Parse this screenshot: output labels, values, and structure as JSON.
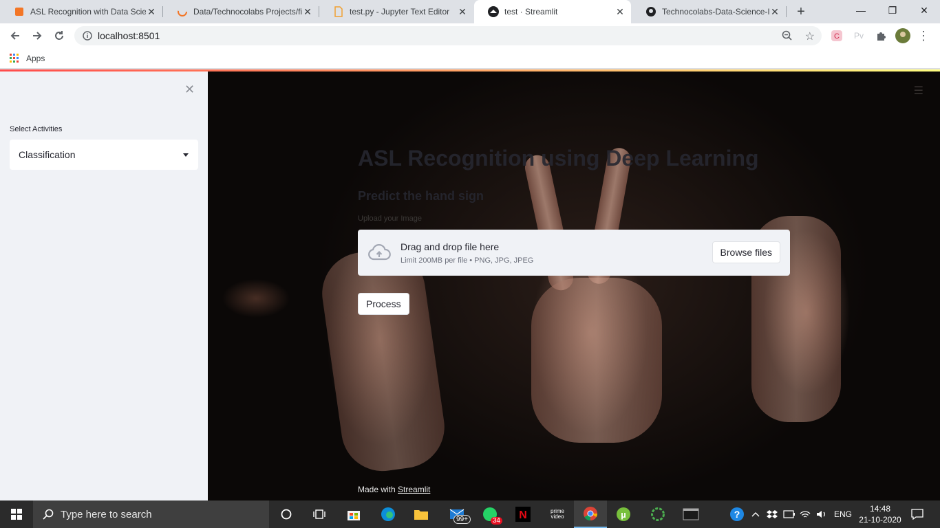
{
  "browser": {
    "tabs": [
      {
        "title": "ASL Recognition with Data Scie",
        "icon": "jupyter-notebook-icon",
        "active": false
      },
      {
        "title": "Data/Technocolabs Projects/fin",
        "icon": "jupyter-loading-icon",
        "active": false
      },
      {
        "title": "test.py - Jupyter Text Editor",
        "icon": "text-file-icon",
        "active": false
      },
      {
        "title": "test · Streamlit",
        "icon": "streamlit-icon",
        "active": true
      },
      {
        "title": "Technocolabs-Data-Science-In",
        "icon": "github-icon",
        "active": false
      }
    ],
    "new_tab": "+",
    "url": "localhost:8501",
    "bookmarks_apps": "Apps"
  },
  "sidebar": {
    "select_label": "Select Activities",
    "select_value": "Classification"
  },
  "main": {
    "title": "ASL Recognition using Deep Learning",
    "subtitle": "Predict the hand sign",
    "upload_label": "Upload your Image",
    "dropzone_title": "Drag and drop file here",
    "dropzone_limit": "Limit 200MB per file • PNG, JPG, JPEG",
    "browse_button": "Browse files",
    "process_button": "Process",
    "footer_prefix": "Made with ",
    "footer_link": "Streamlit"
  },
  "taskbar": {
    "search_placeholder": "Type here to search",
    "mail_badge": "99+",
    "whatsapp_badge": "34",
    "prime_label": "prime video",
    "language": "ENG",
    "time": "14:48",
    "date": "21-10-2020"
  },
  "colors": {
    "streamlit_accent": "#ff4b4b",
    "sidebar_bg": "#f0f2f6",
    "taskbar_bg": "#2b2b2b"
  }
}
